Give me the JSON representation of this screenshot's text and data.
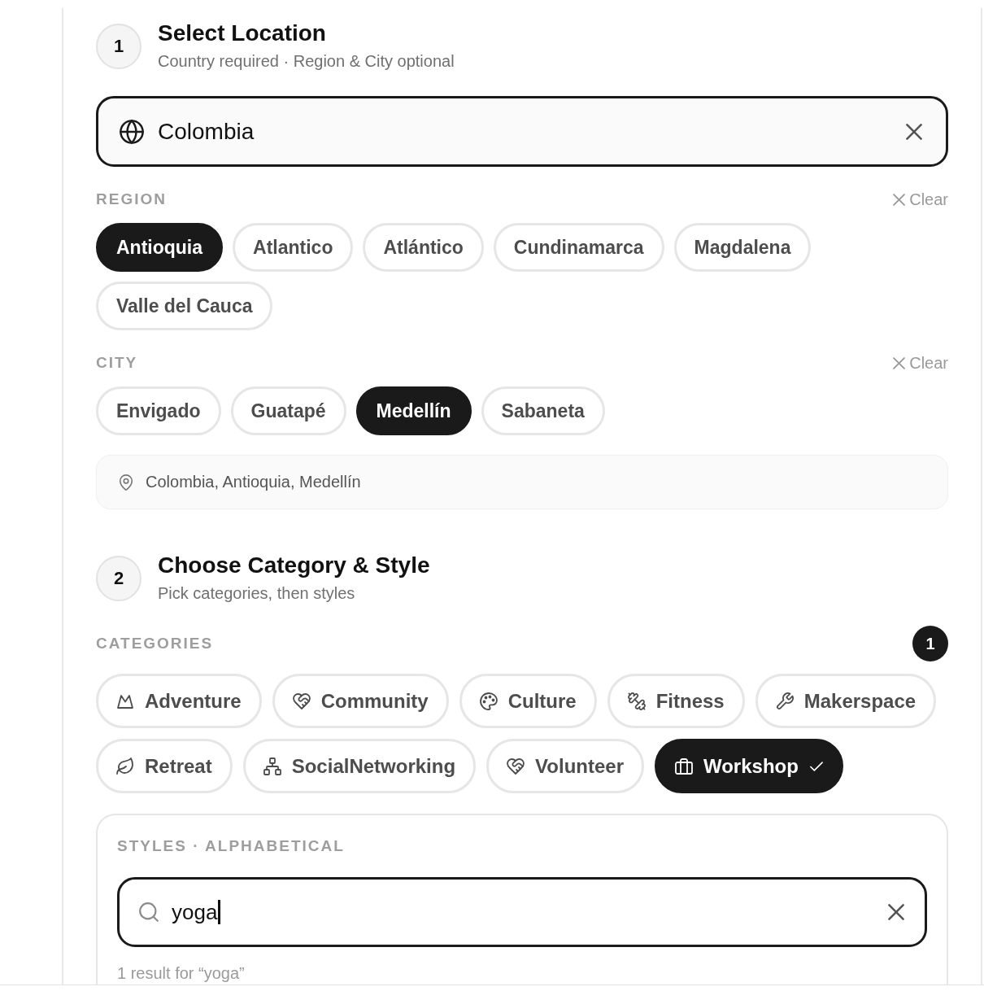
{
  "location_step": {
    "number": "1",
    "title": "Select Location",
    "subtitle": "Country required · Region & City optional",
    "country_field": {
      "value": "Colombia"
    },
    "region": {
      "label": "REGION",
      "clear": "Clear",
      "options": [
        {
          "label": "Antioquia",
          "selected": true
        },
        {
          "label": "Atlantico",
          "selected": false
        },
        {
          "label": "Atlántico",
          "selected": false
        },
        {
          "label": "Cundinamarca",
          "selected": false
        },
        {
          "label": "Magdalena",
          "selected": false
        },
        {
          "label": "Valle del Cauca",
          "selected": false
        }
      ]
    },
    "city": {
      "label": "CITY",
      "clear": "Clear",
      "options": [
        {
          "label": "Envigado",
          "selected": false
        },
        {
          "label": "Guatapé",
          "selected": false
        },
        {
          "label": "Medellín",
          "selected": true
        },
        {
          "label": "Sabaneta",
          "selected": false
        }
      ]
    },
    "summary": "Colombia, Antioquia, Medellín"
  },
  "category_step": {
    "number": "2",
    "title": "Choose Category & Style",
    "subtitle": "Pick categories, then styles",
    "categories": {
      "label": "CATEGORIES",
      "count": "1",
      "options": [
        {
          "label": "Adventure",
          "kind": "mountain",
          "selected": false
        },
        {
          "label": "Community",
          "kind": "handshake",
          "selected": false
        },
        {
          "label": "Culture",
          "kind": "palette",
          "selected": false
        },
        {
          "label": "Fitness",
          "kind": "dumbbell",
          "selected": false
        },
        {
          "label": "Makerspace",
          "kind": "wrench",
          "selected": false
        },
        {
          "label": "Retreat",
          "kind": "leaf",
          "selected": false
        },
        {
          "label": "SocialNetworking",
          "kind": "network",
          "selected": false
        },
        {
          "label": "Volunteer",
          "kind": "handshake",
          "selected": false
        },
        {
          "label": "Workshop",
          "kind": "briefcase",
          "selected": true
        }
      ]
    },
    "styles": {
      "label": "STYLES · ALPHABETICAL",
      "search": {
        "value": "yoga"
      },
      "result": "1 result for “yoga”"
    }
  }
}
